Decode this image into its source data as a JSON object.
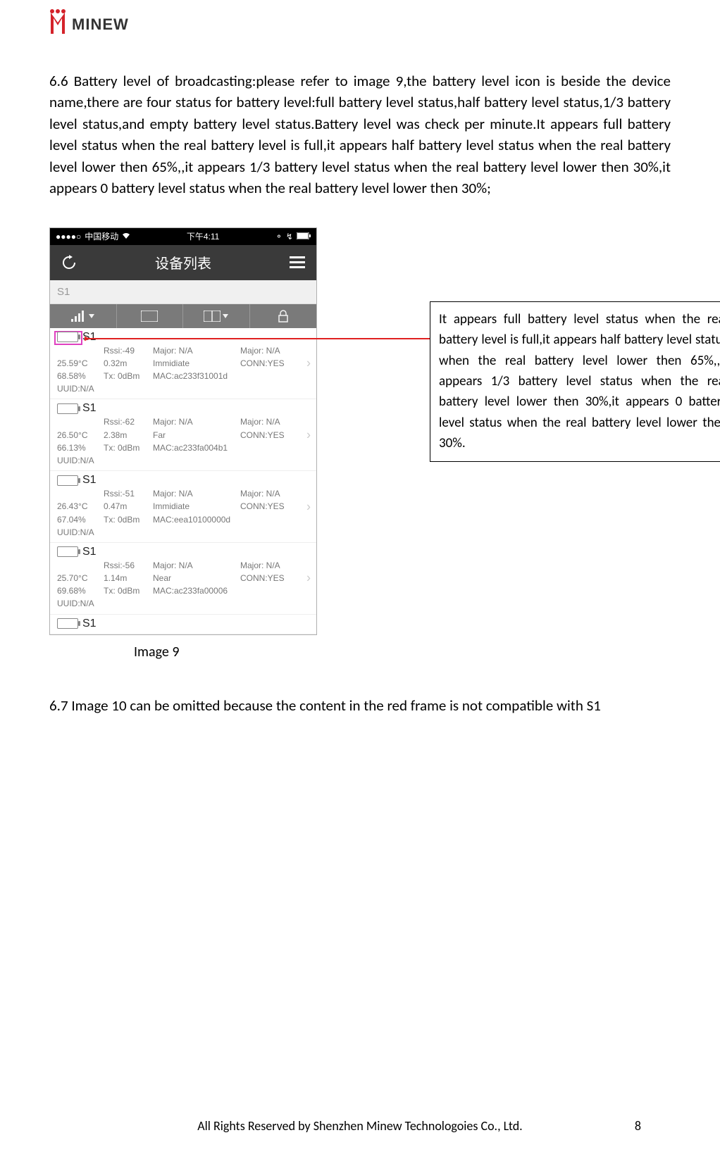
{
  "logo_text": "MINEW",
  "para66": "6.6 Battery level of broadcasting:please refer to image 9,the battery level icon is beside the device name,there are four status for battery level:full battery level status,half battery level status,1/3 battery level status,and empty battery level status.Battery level was check per minute.It appears full battery level status when the real battery level is full,it appears half battery level status when the real battery level lower then 65%,,it appears 1/3 battery level status when the real battery level lower then 30%,it appears 0 battery level status when the real battery level lower then 30%;",
  "phone": {
    "carrier": "中国移动",
    "time": "下午4:11",
    "nav_title": "设备列表",
    "search_text": "S1",
    "rows": [
      {
        "name": "S1",
        "rssi": "Rssi:-49",
        "temp": "25.59°C",
        "dist": "0.32m",
        "batt": "68.58%",
        "tx": "Tx: 0dBm",
        "uuid": "UUID:N/A",
        "maj1": "Major: N/A",
        "maj2": "Major: N/A",
        "imm": "Immidiate",
        "conn": "CONN:YES",
        "mac": "MAC:ac233f31001d",
        "highlight": true
      },
      {
        "name": "S1",
        "rssi": "Rssi:-62",
        "temp": "26.50°C",
        "dist": "2.38m",
        "batt": "66.13%",
        "tx": "Tx: 0dBm",
        "uuid": "UUID:N/A",
        "maj1": "Major: N/A",
        "maj2": "Major: N/A",
        "imm": "Far",
        "conn": "CONN:YES",
        "mac": "MAC:ac233fa004b1"
      },
      {
        "name": "S1",
        "rssi": "Rssi:-51",
        "temp": "26.43°C",
        "dist": "0.47m",
        "batt": "67.04%",
        "tx": "Tx: 0dBm",
        "uuid": "UUID:N/A",
        "maj1": "Major: N/A",
        "maj2": "Major: N/A",
        "imm": "Immidiate",
        "conn": "CONN:YES",
        "mac": "MAC:eea10100000d"
      },
      {
        "name": "S1",
        "rssi": "Rssi:-56",
        "temp": "25.70°C",
        "dist": "1.14m",
        "batt": "69.68%",
        "tx": "Tx: 0dBm",
        "uuid": "UUID:N/A",
        "maj1": "Major: N/A",
        "maj2": "Major: N/A",
        "imm": "Near",
        "conn": "CONN:YES",
        "mac": "MAC:ac233fa00006"
      },
      {
        "name": "S1",
        "rssi": "",
        "temp": "",
        "dist": "",
        "batt": "",
        "tx": "",
        "uuid": "",
        "maj1": "",
        "maj2": "",
        "imm": "",
        "conn": "",
        "mac": "",
        "partial": true
      }
    ]
  },
  "image_caption": "Image 9",
  "callout": "It appears full battery level status when the real battery level is full,it appears half battery level status when the real battery level lower then 65%,,it appears 1/3 battery level status when the real battery level lower then 30%,it appears 0 battery level status when the real battery level lower then 30%.",
  "para67": "6.7 Image 10 can be omitted because the content in the red frame is not compatible with S1",
  "footer": "All Rights Reserved by Shenzhen Minew Technologoies Co., Ltd.",
  "page_num": "8"
}
